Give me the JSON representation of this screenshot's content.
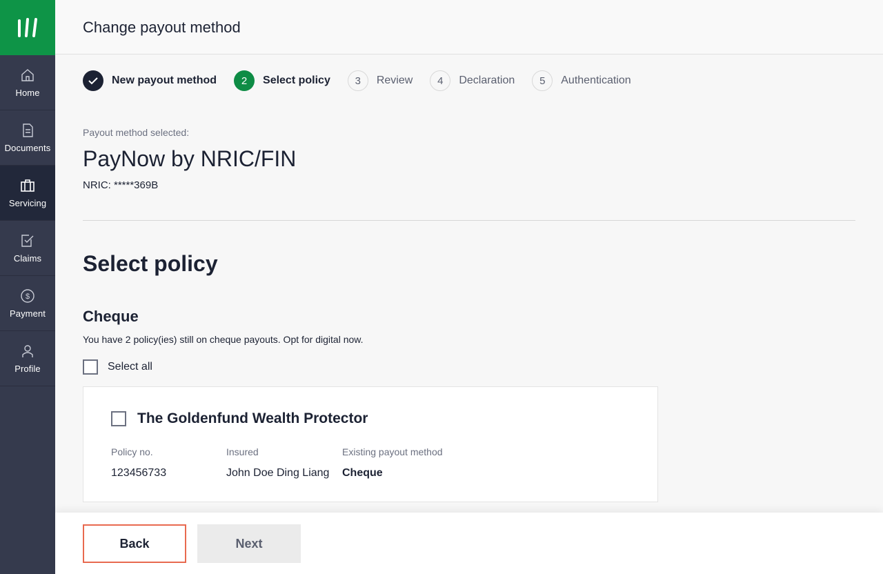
{
  "app": {
    "logo_icon": "brand-logo-icon",
    "brand_color": "#0e9447"
  },
  "sidebar": {
    "items": [
      {
        "label": "Home",
        "icon": "home-icon",
        "active": false
      },
      {
        "label": "Documents",
        "icon": "document-icon",
        "active": false
      },
      {
        "label": "Servicing",
        "icon": "briefcase-icon",
        "active": true
      },
      {
        "label": "Claims",
        "icon": "claims-icon",
        "active": false
      },
      {
        "label": "Payment",
        "icon": "dollar-icon",
        "active": false
      },
      {
        "label": "Profile",
        "icon": "user-icon",
        "active": false
      }
    ]
  },
  "header": {
    "title": "Change payout method"
  },
  "stepper": {
    "steps": [
      {
        "number": "",
        "label": "New payout method",
        "state": "done"
      },
      {
        "number": "2",
        "label": "Select policy",
        "state": "current"
      },
      {
        "number": "3",
        "label": "Review",
        "state": "todo"
      },
      {
        "number": "4",
        "label": "Declaration",
        "state": "todo"
      },
      {
        "number": "5",
        "label": "Authentication",
        "state": "todo"
      }
    ]
  },
  "payout": {
    "caption": "Payout method selected:",
    "name": "PayNow by NRIC/FIN",
    "nric": "NRIC: *****369B"
  },
  "section": {
    "title": "Select policy"
  },
  "group": {
    "title": "Cheque",
    "description": "You have 2 policy(ies) still on cheque payouts. Opt for digital now.",
    "select_all_label": "Select all"
  },
  "policy": {
    "name": "The Goldenfund Wealth Protector",
    "policy_no_label": "Policy no.",
    "policy_no": "123456733",
    "insured_label": "Insured",
    "insured": "John Doe Ding Liang",
    "method_label": "Existing payout method",
    "method": "Cheque"
  },
  "footer": {
    "back_label": "Back",
    "next_label": "Next"
  },
  "colors": {
    "sidebar": "#353a4d",
    "sidebar_active": "#22283a",
    "step_current": "#0e8c45",
    "back_border": "#e8694f"
  }
}
